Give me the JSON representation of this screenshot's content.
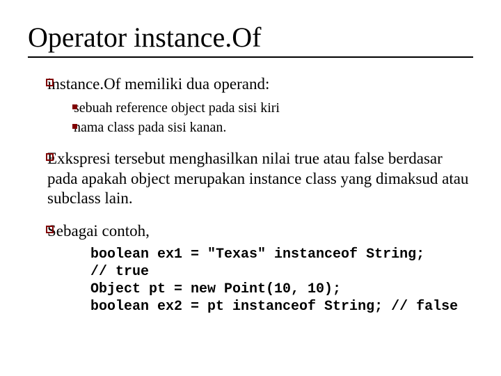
{
  "title": "Operator instance.Of",
  "bullets": [
    {
      "text": "instance.Of memiliki dua operand:",
      "sub": [
        "sebuah reference object pada sisi kiri",
        "nama class pada sisi kanan."
      ]
    },
    {
      "text": "Exkspresi tersebut menghasilkan nilai true atau false berdasar pada apakah object merupakan instance class yang dimaksud atau subclass lain."
    },
    {
      "text": "Sebagai contoh,",
      "code": "boolean ex1 = \"Texas\" instanceof String;\n// true\nObject pt = new Point(10, 10);\nboolean ex2 = pt instanceof String; // false"
    }
  ]
}
